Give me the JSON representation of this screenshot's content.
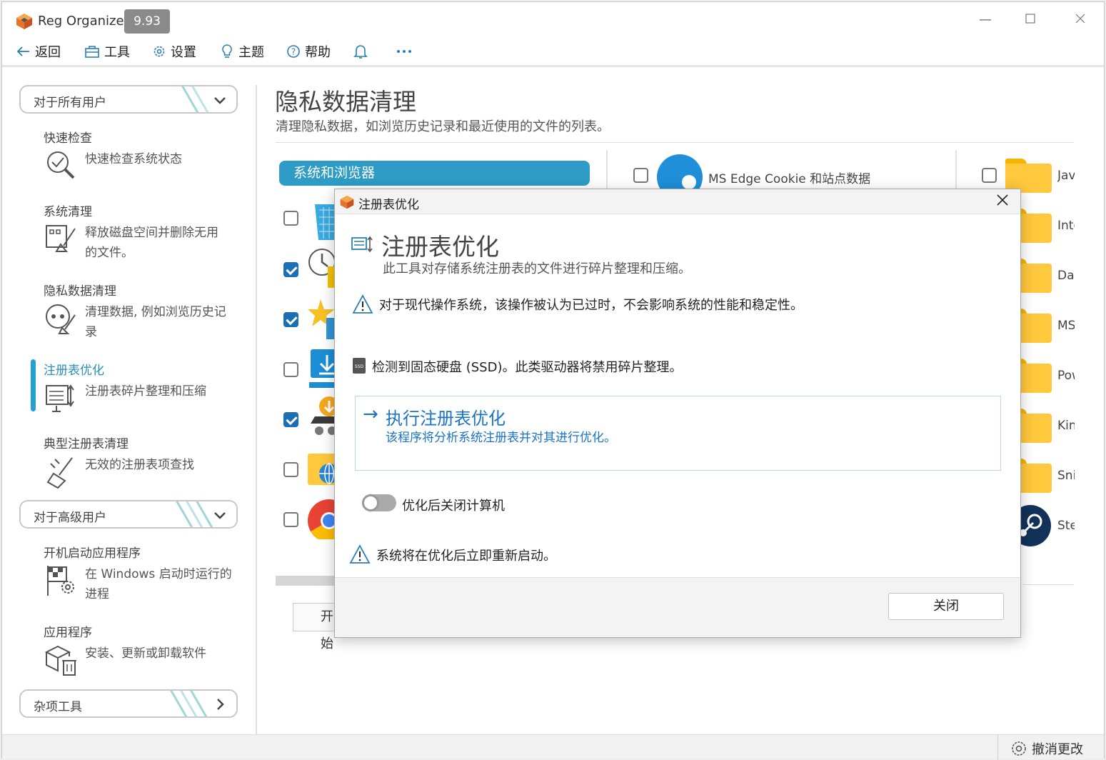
{
  "app": {
    "name": "Reg Organizer",
    "version": "9.93"
  },
  "toolbar": {
    "back": "返回",
    "tools": "工具",
    "settings": "设置",
    "theme": "主题",
    "help": "帮助"
  },
  "sidebar": {
    "group_all_users": "对于所有用户",
    "group_advanced": "对于高级用户",
    "group_misc": "杂项工具",
    "items": [
      {
        "title": "快速检查",
        "desc": "快速检查系统状态"
      },
      {
        "title": "系统清理",
        "desc": "释放磁盘空间并删除无用的文件。"
      },
      {
        "title": "隐私数据清理",
        "desc": "清理数据, 例如浏览历史记录"
      },
      {
        "title": "注册表优化",
        "desc": "注册表碎片整理和压缩"
      },
      {
        "title": "典型注册表清理",
        "desc": "无效的注册表项查找"
      },
      {
        "title": "开机启动应用程序",
        "desc": "在 Windows 启动时运行的进程"
      },
      {
        "title": "应用程序",
        "desc": "安装、更新或卸载软件"
      }
    ]
  },
  "main": {
    "title": "隐私数据清理",
    "subtitle": "清理隐私数据，如浏览历史记录和最近使用的文件的列表。",
    "category": "系统和浏览器",
    "edge_item": "MS Edge Cookie 和站点数据",
    "right_items": [
      "Java",
      "Internet",
      "Data",
      "MS",
      "Power",
      "Kingsoft",
      "Snip",
      "Steam"
    ],
    "start_button": "开始"
  },
  "dialog": {
    "window_title": "注册表优化",
    "heading": "注册表优化",
    "subheading": "此工具对存储系统注册表的文件进行碎片整理和压缩。",
    "warning_outdated": "对于现代操作系统，该操作被认为已过时，不会影响系统的性能和稳定性。",
    "ssd_notice": "检测到固态硬盘 (SSD)。此类驱动器将禁用碎片整理。",
    "action_title": "执行注册表优化",
    "action_desc": "该程序将分析系统注册表并对其进行优化。",
    "toggle_label": "优化后关闭计算机",
    "restart_notice": "系统将在优化后立即重新启动。",
    "close_button": "关闭"
  },
  "statusbar": {
    "undo": "撤消更改"
  },
  "colors": {
    "accent": "#2e9cc6",
    "link": "#1a73c4",
    "checkbox": "#1b6fb6"
  }
}
